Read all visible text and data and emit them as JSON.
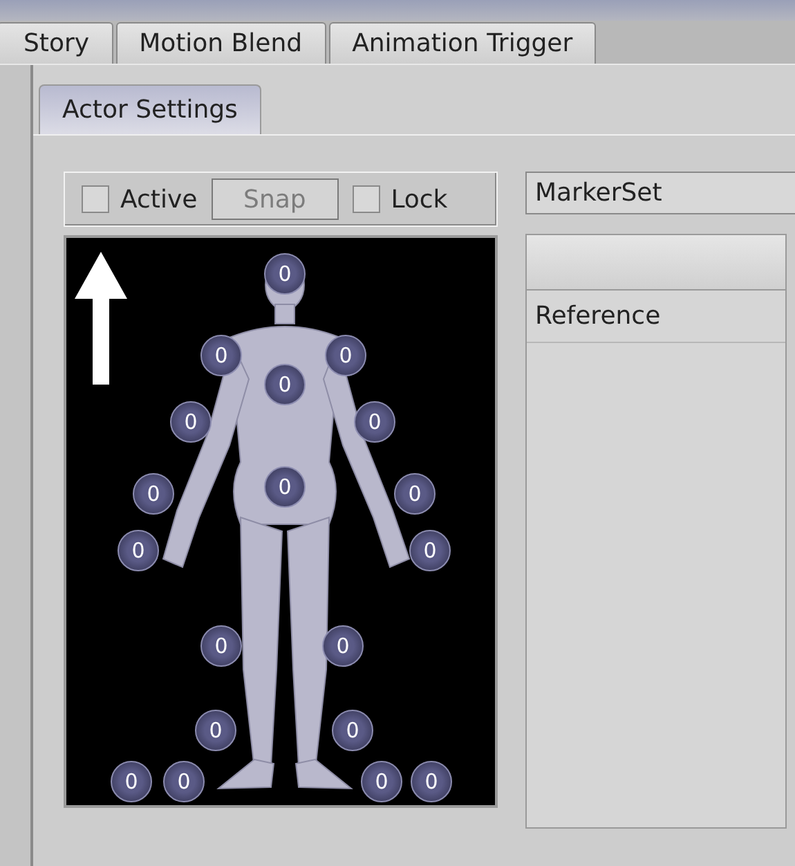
{
  "tabs": [
    {
      "label": "Story",
      "selected": false
    },
    {
      "label": "Motion Blend",
      "selected": false
    },
    {
      "label": "Animation Trigger",
      "selected": false
    }
  ],
  "sub_tabs": [
    {
      "label": "Actor Settings",
      "selected": true
    }
  ],
  "toolbar": {
    "active": {
      "label": "Active",
      "checked": false
    },
    "snap": {
      "label": "Snap",
      "disabled": true
    },
    "lock": {
      "label": "Lock",
      "checked": false
    }
  },
  "viewport": {
    "markers": [
      {
        "label": "0"
      },
      {
        "label": "0"
      },
      {
        "label": "0"
      },
      {
        "label": "0"
      },
      {
        "label": "0"
      },
      {
        "label": "0"
      },
      {
        "label": "0"
      },
      {
        "label": "0"
      },
      {
        "label": "0"
      },
      {
        "label": "0"
      },
      {
        "label": "0"
      },
      {
        "label": "0"
      },
      {
        "label": "0"
      },
      {
        "label": "0"
      },
      {
        "label": "0"
      },
      {
        "label": "0"
      },
      {
        "label": "0"
      },
      {
        "label": "0"
      },
      {
        "label": "0"
      }
    ]
  },
  "marker_set": {
    "value": "MarkerSet"
  },
  "list": {
    "items": [
      {
        "label": "Reference",
        "selected": false
      }
    ]
  }
}
